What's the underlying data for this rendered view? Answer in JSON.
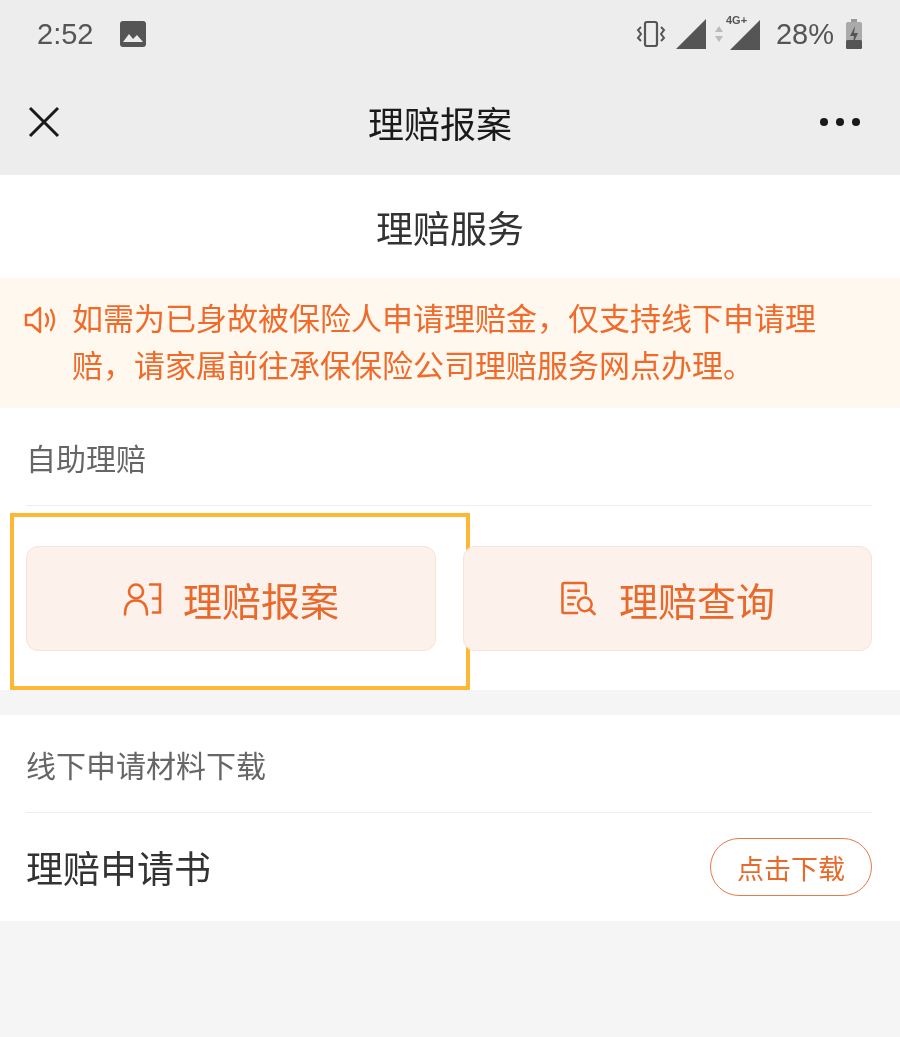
{
  "status_bar": {
    "time": "2:52",
    "network_type": "4G+",
    "battery": "28%"
  },
  "nav_bar": {
    "title": "理赔报案"
  },
  "page_title": "理赔服务",
  "notice": {
    "text": "如需为已身故被保险人申请理赔金，仅支持线下申请理赔，请家属前往承保保险公司理赔服务网点办理。"
  },
  "self_service": {
    "label": "自助理赔",
    "actions": [
      {
        "label": "理赔报案",
        "kind": "report",
        "selected": true
      },
      {
        "label": "理赔查询",
        "kind": "query",
        "selected": false
      }
    ]
  },
  "downloads": {
    "label": "线下申请材料下载",
    "items": [
      {
        "name": "理赔申请书",
        "button": "点击下载"
      }
    ]
  }
}
